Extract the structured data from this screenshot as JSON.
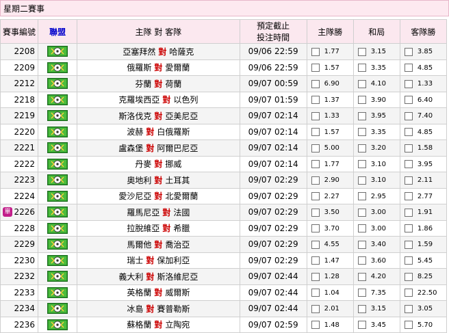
{
  "day_header": "星期二賽事",
  "columns": {
    "no": "賽事編號",
    "league": "聯盟",
    "match": "主隊 對 客隊",
    "time_line1": "預定截止",
    "time_line2": "投注時間",
    "home": "主隊勝",
    "draw": "和局",
    "away": "客隊勝"
  },
  "vs_label": "對",
  "single_badge": "單",
  "league_icon": "soccer-ball-league-icon",
  "colors": {
    "header_bg": "#fde9f0",
    "vs": "#cc0000",
    "league_head": "#0000cc",
    "badge": "#c21e8a"
  },
  "rows": [
    {
      "no": "2208",
      "home": "亞塞拜然",
      "away": "哈薩克",
      "time": "09/06 22:59",
      "o1": "1.77",
      "ox": "3.15",
      "o2": "3.85",
      "single": false
    },
    {
      "no": "2209",
      "home": "俄羅斯",
      "away": "愛爾蘭",
      "time": "09/06 22:59",
      "o1": "1.57",
      "ox": "3.35",
      "o2": "4.85",
      "single": false
    },
    {
      "no": "2212",
      "home": "芬蘭",
      "away": "荷蘭",
      "time": "09/07 00:59",
      "o1": "6.90",
      "ox": "4.10",
      "o2": "1.33",
      "single": false
    },
    {
      "no": "2218",
      "home": "克羅埃西亞",
      "away": "以色列",
      "time": "09/07 01:59",
      "o1": "1.37",
      "ox": "3.90",
      "o2": "6.40",
      "single": false
    },
    {
      "no": "2219",
      "home": "斯洛伐克",
      "away": "亞美尼亞",
      "time": "09/07 02:14",
      "o1": "1.33",
      "ox": "3.95",
      "o2": "7.40",
      "single": false
    },
    {
      "no": "2220",
      "home": "波赫",
      "away": "白俄羅斯",
      "time": "09/07 02:14",
      "o1": "1.57",
      "ox": "3.35",
      "o2": "4.85",
      "single": false
    },
    {
      "no": "2221",
      "home": "盧森堡",
      "away": "阿爾巴尼亞",
      "time": "09/07 02:14",
      "o1": "5.00",
      "ox": "3.20",
      "o2": "1.58",
      "single": false
    },
    {
      "no": "2222",
      "home": "丹麥",
      "away": "挪威",
      "time": "09/07 02:14",
      "o1": "1.77",
      "ox": "3.10",
      "o2": "3.95",
      "single": false
    },
    {
      "no": "2223",
      "home": "奧地利",
      "away": "土耳其",
      "time": "09/07 02:29",
      "o1": "2.90",
      "ox": "3.10",
      "o2": "2.11",
      "single": false
    },
    {
      "no": "2224",
      "home": "愛沙尼亞",
      "away": "北愛爾蘭",
      "time": "09/07 02:29",
      "o1": "2.27",
      "ox": "2.95",
      "o2": "2.77",
      "single": false
    },
    {
      "no": "2226",
      "home": "羅馬尼亞",
      "away": "法國",
      "time": "09/07 02:29",
      "o1": "3.50",
      "ox": "3.00",
      "o2": "1.91",
      "single": true
    },
    {
      "no": "2228",
      "home": "拉脫維亞",
      "away": "希臘",
      "time": "09/07 02:29",
      "o1": "3.70",
      "ox": "3.00",
      "o2": "1.86",
      "single": false
    },
    {
      "no": "2229",
      "home": "馬爾他",
      "away": "喬治亞",
      "time": "09/07 02:29",
      "o1": "4.55",
      "ox": "3.40",
      "o2": "1.59",
      "single": false
    },
    {
      "no": "2230",
      "home": "瑞士",
      "away": "保加利亞",
      "time": "09/07 02:29",
      "o1": "1.47",
      "ox": "3.60",
      "o2": "5.45",
      "single": false
    },
    {
      "no": "2232",
      "home": "義大利",
      "away": "斯洛維尼亞",
      "time": "09/07 02:44",
      "o1": "1.28",
      "ox": "4.20",
      "o2": "8.25",
      "single": false
    },
    {
      "no": "2233",
      "home": "英格蘭",
      "away": "威爾斯",
      "time": "09/07 02:44",
      "o1": "1.04",
      "ox": "7.35",
      "o2": "22.50",
      "single": false
    },
    {
      "no": "2234",
      "home": "冰島",
      "away": "賽普勒斯",
      "time": "09/07 02:44",
      "o1": "2.01",
      "ox": "3.15",
      "o2": "3.05",
      "single": false
    },
    {
      "no": "2236",
      "home": "蘇格蘭",
      "away": "立陶宛",
      "time": "09/07 02:59",
      "o1": "1.48",
      "ox": "3.45",
      "o2": "5.70",
      "single": false
    }
  ]
}
